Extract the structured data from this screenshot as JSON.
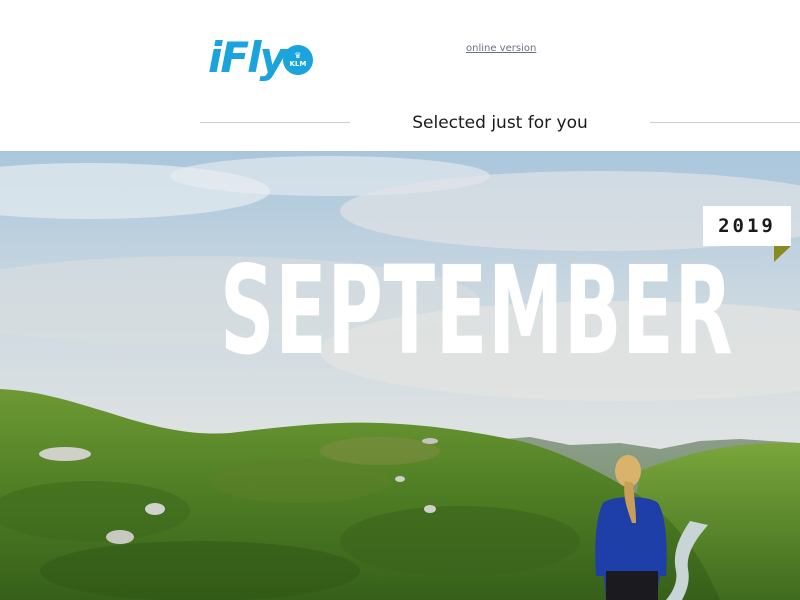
{
  "header": {
    "logo": {
      "wordmark": "iFly",
      "badge": "KLM",
      "color": "#1aa3dd"
    },
    "online_version_link": "online version",
    "tagline": "Selected just for you"
  },
  "hero": {
    "year": "2019",
    "month": "SEPTEMBER",
    "image_description_icon": "landscape-photo",
    "colors": {
      "sky": "#cfd8dd",
      "hills": "#5c8a2c",
      "jacket": "#1f3fa8",
      "tab_fold": "#8a8a22"
    }
  }
}
